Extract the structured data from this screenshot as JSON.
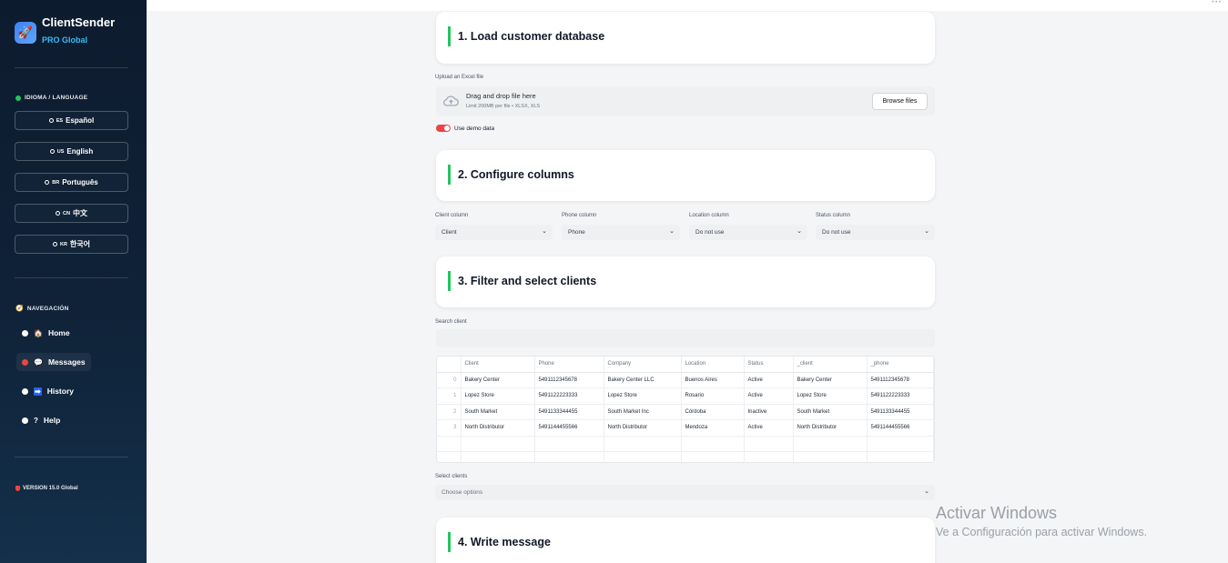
{
  "sidebar": {
    "brand_name": "ClientSender",
    "brand_sub": "PRO Global",
    "language_title": "IDIOMA / LANGUAGE",
    "languages": [
      {
        "flag": "ES",
        "label": "Español"
      },
      {
        "flag": "US",
        "label": "English"
      },
      {
        "flag": "BR",
        "label": "Português"
      },
      {
        "flag": "CN",
        "label": "中文"
      },
      {
        "flag": "KR",
        "label": "한국어"
      }
    ],
    "nav_title": "NAVEGACIÓN",
    "nav": [
      {
        "icon": "🏠",
        "label": "Home"
      },
      {
        "icon": "💬",
        "label": "Messages"
      },
      {
        "icon": "➡",
        "label": "History"
      },
      {
        "icon": "?",
        "label": "Help"
      }
    ],
    "version": "VERSION 15.0 Global"
  },
  "sections": {
    "s1": "1. Load customer database",
    "s2": "2. Configure columns",
    "s3": "3. Filter and select clients",
    "s4": "4. Write message"
  },
  "upload": {
    "label": "Upload an Excel file",
    "main": "Drag and drop file here",
    "sub": "Limit 200MB per file • XLSX, XLS",
    "browse": "Browse files"
  },
  "demo_toggle": "Use demo data",
  "columns": {
    "client_label": "Client column",
    "client_value": "Client",
    "phone_label": "Phone column",
    "phone_value": "Phone",
    "location_label": "Location column",
    "location_value": "Do not use",
    "status_label": "Status column",
    "status_value": "Do not use"
  },
  "search_label": "Search client",
  "table": {
    "headers": [
      "",
      "Client",
      "Phone",
      "Company",
      "Location",
      "Status",
      "_client",
      "_phone"
    ],
    "rows": [
      [
        "0",
        "Bakery Center",
        "5491112345678",
        "Bakery Center LLC",
        "Buenos Aires",
        "Active",
        "Bakery Center",
        "5491112345678"
      ],
      [
        "1",
        "Lopez Store",
        "5491122223333",
        "Lopez Store",
        "Rosario",
        "Active",
        "Lopez Store",
        "5491122223333"
      ],
      [
        "2",
        "South Market",
        "5491133344455",
        "South Market Inc",
        "Córdoba",
        "Inactive",
        "South Market",
        "5491133344455"
      ],
      [
        "3",
        "North Distributor",
        "5491144455566",
        "North Distributor",
        "Mendoza",
        "Active",
        "North Distributor",
        "5491144455566"
      ]
    ]
  },
  "select_clients": {
    "label": "Select clients",
    "placeholder": "Choose options"
  },
  "watermark": {
    "line1": "Activar Windows",
    "line2": "Ve a Configuración para activar Windows."
  },
  "colors": {
    "accent": "#22c55e",
    "toggle": "#ef4444",
    "sidebar": "#0d1b2e",
    "brand_sub": "#38bdf8"
  }
}
